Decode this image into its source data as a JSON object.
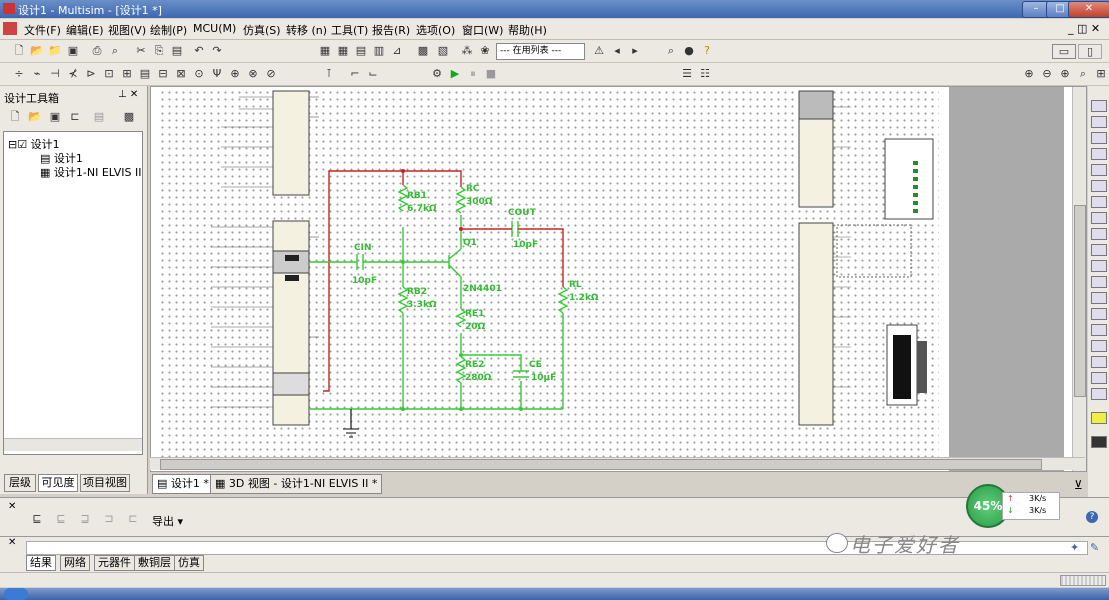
{
  "window": {
    "title": "设计1 - Multisim - [设计1 *]"
  },
  "menu": [
    "文件(F)",
    "编辑(E)",
    "视图(V)",
    "绘制(P)",
    "MCU(M)",
    "仿真(S)",
    "转移 (n)",
    "工具(T)",
    "报告(R)",
    "选项(O)",
    "窗口(W)",
    "帮助(H)"
  ],
  "toolbar": {
    "in_use_combo": "--- 在用列表 ---"
  },
  "left_panel": {
    "title": "设计工具箱",
    "tree": {
      "root": "设计1",
      "child1": "设计1",
      "child2": "设计1-NI ELVIS II"
    },
    "tabs": [
      "层级",
      "可见度",
      "项目视图"
    ]
  },
  "doc_tabs": [
    "设计1 *",
    "3D 视图 - 设计1-NI ELVIS II *"
  ],
  "schematic": {
    "components": {
      "rb1": {
        "name": "RB1",
        "value": "6.7kΩ"
      },
      "rc": {
        "name": "RC",
        "value": "300Ω"
      },
      "cout": {
        "name": "COUT",
        "value": "10pF"
      },
      "cin": {
        "name": "CIN",
        "value": "10pF"
      },
      "q1": {
        "name": "Q1",
        "value": "2N4401"
      },
      "rl": {
        "name": "RL",
        "value": "1.2kΩ"
      },
      "rb2": {
        "name": "RB2",
        "value": "3.3kΩ"
      },
      "re1": {
        "name": "RE1",
        "value": "20Ω"
      },
      "re2": {
        "name": "RE2",
        "value": "280Ω"
      },
      "ce": {
        "name": "CE",
        "value": "10μF"
      }
    }
  },
  "spreadsheet": {
    "export_label": "导出",
    "tabs": [
      "结果",
      "网络",
      "元器件",
      "敷铜层",
      "仿真"
    ]
  },
  "gauge": {
    "percent": "45%",
    "up": "3K/s",
    "down": "3K/s"
  },
  "watermark": "电子爱好者",
  "colors": {
    "wire_green": "#33cc33",
    "wire_red": "#cc2222",
    "title_blue": "#3d67b0"
  }
}
